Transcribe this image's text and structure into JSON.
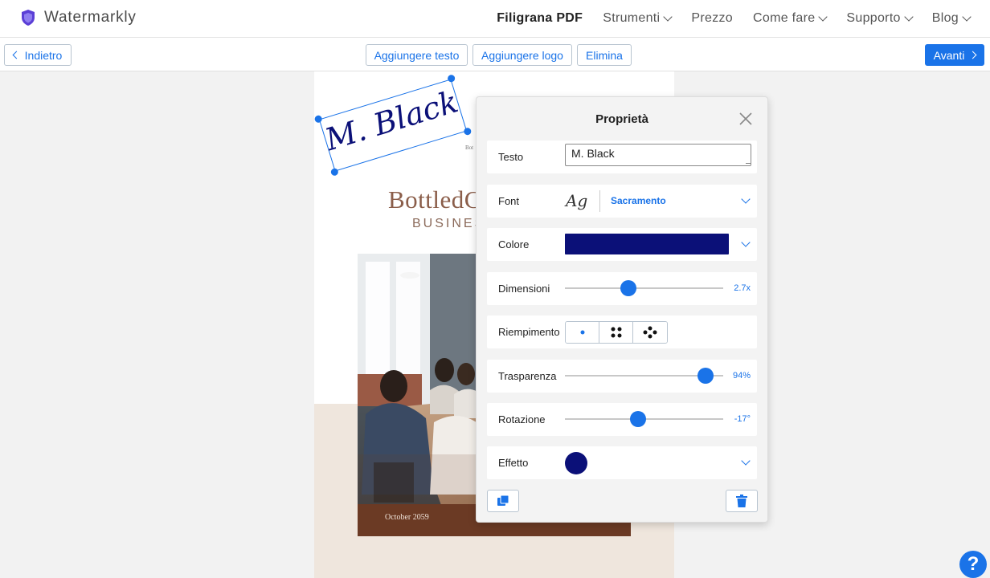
{
  "app": {
    "name": "Watermarkly"
  },
  "nav": {
    "items": [
      {
        "label": "Filigrana PDF",
        "active": true,
        "dropdown": false
      },
      {
        "label": "Strumenti",
        "active": false,
        "dropdown": true
      },
      {
        "label": "Prezzo",
        "active": false,
        "dropdown": false
      },
      {
        "label": "Come fare",
        "active": false,
        "dropdown": true
      },
      {
        "label": "Supporto",
        "active": false,
        "dropdown": true
      },
      {
        "label": "Blog",
        "active": false,
        "dropdown": true
      }
    ]
  },
  "toolbar": {
    "back_label": "Indietro",
    "add_text_label": "Aggiungere testo",
    "add_logo_label": "Aggiungere logo",
    "delete_label": "Elimina",
    "next_label": "Avanti"
  },
  "document": {
    "title": "BottledC",
    "subtitle": "BUSINES",
    "small_text": "Bot",
    "date": "October 2059"
  },
  "watermark": {
    "text": "M. Black",
    "color": "#0b1078"
  },
  "panel": {
    "title": "Proprietà",
    "text": {
      "label": "Testo",
      "value": "M. Black"
    },
    "font": {
      "label": "Font",
      "preview": "Ag",
      "name": "Sacramento"
    },
    "color": {
      "label": "Colore",
      "value": "#0b1078"
    },
    "size": {
      "label": "Dimensioni",
      "value": "2.7x",
      "fraction": 0.4
    },
    "fill": {
      "label": "Riempimento",
      "options": [
        "single",
        "grid",
        "diagonal"
      ]
    },
    "transparency": {
      "label": "Trasparenza",
      "value": "94%",
      "fraction": 0.89
    },
    "rotation": {
      "label": "Rotazione",
      "value": "-17°",
      "fraction": 0.46
    },
    "effect": {
      "label": "Effetto",
      "color": "#0b1078"
    }
  },
  "help": {
    "label": "?"
  },
  "colors": {
    "accent": "#1a73e8",
    "photo_dark": "#6b3a24"
  }
}
